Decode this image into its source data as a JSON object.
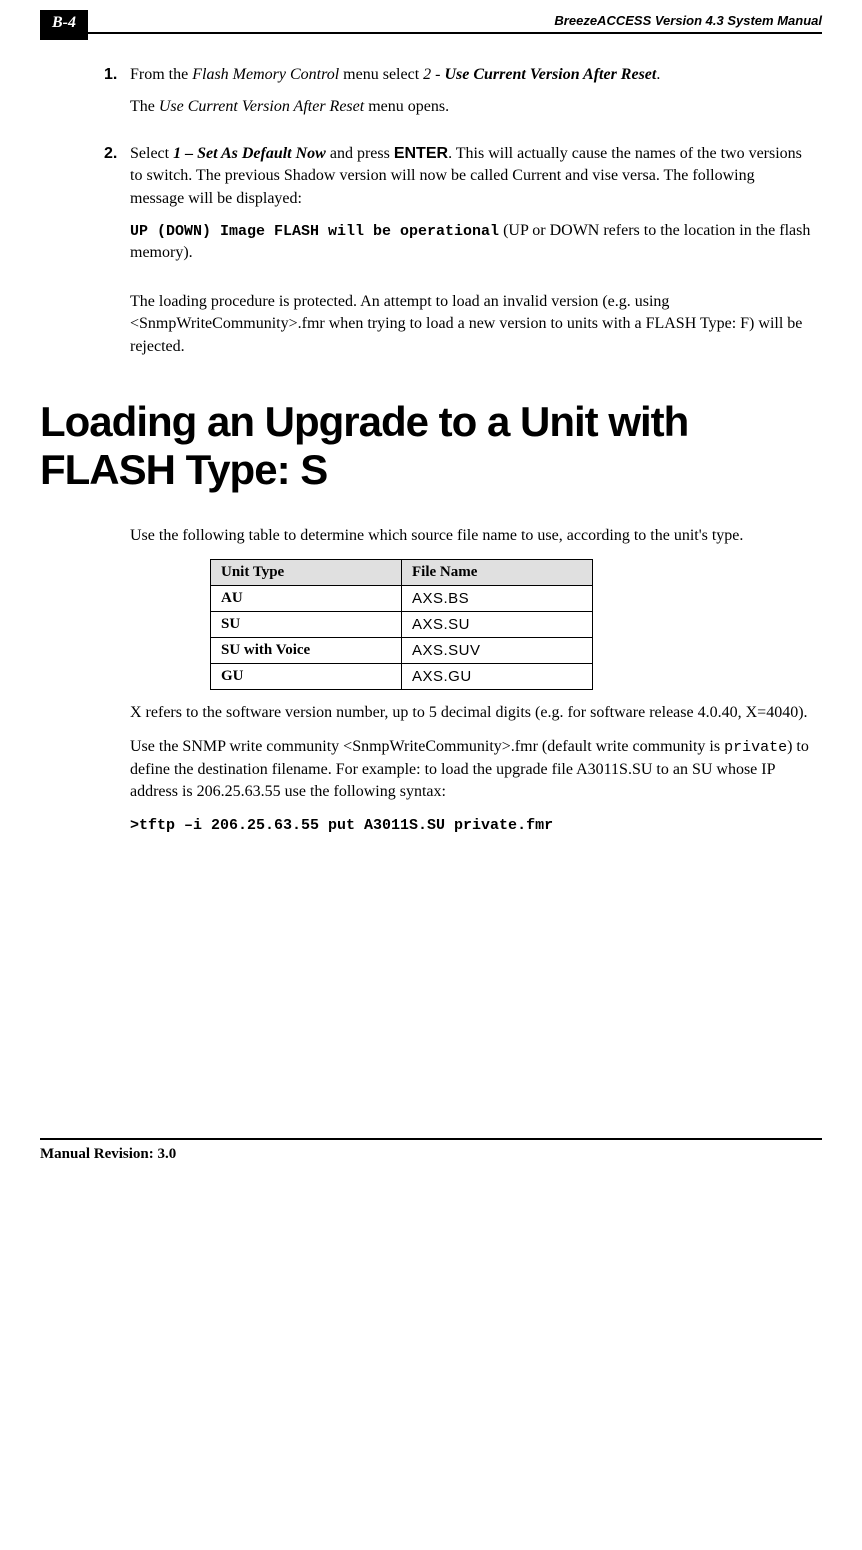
{
  "header": {
    "page_number": "B-4",
    "title": "BreezeACCESS Version 4.3 System Manual"
  },
  "steps": [
    {
      "num": "1.",
      "pre": "From the ",
      "menu": "Flash Memory Control",
      "mid": " menu select ",
      "option_num": "2",
      "sep": " - ",
      "option_label": "Use Current Version After Reset",
      "post": ".",
      "sub": {
        "pre": "The ",
        "menu": "Use Current Version After Reset",
        "post": " menu opens."
      }
    },
    {
      "num": "2.",
      "pre": "Select  ",
      "option": "1 – Set As Default Now",
      "mid": " and press ",
      "key": "ENTER",
      "post": ". This will actually cause  the names of the two versions to switch. The previous Shadow version will now be called Current and vise versa. The following message will be displayed:",
      "sub": {
        "code": "UP (DOWN) Image FLASH will be operational",
        "post": " (UP or DOWN refers to the location in the flash memory)."
      }
    }
  ],
  "loading_note": "The loading procedure is protected. An attempt to load an invalid version (e.g. using <SnmpWriteCommunity>.fmr when trying to load a new version to units with a FLASH Type: F) will be rejected.",
  "section_title": "Loading an Upgrade to a Unit with FLASH Type: S",
  "table_intro": "Use the following table to determine which source file name to use, according to the unit's type.",
  "table": {
    "headers": [
      "Unit Type",
      "File Name"
    ],
    "rows": [
      [
        "AU",
        "AXS.BS"
      ],
      [
        "SU",
        "AXS.SU"
      ],
      [
        "SU with Voice",
        "AXS.SUV"
      ],
      [
        "GU",
        "AXS.GU"
      ]
    ]
  },
  "x_note": "X refers to the software version number, up to 5 decimal digits (e.g. for software release 4.0.40, X=4040).",
  "snmp_para": {
    "pre": "Use the SNMP write community <SnmpWriteCommunity>.fmr (default write community is ",
    "code": "private",
    "post": ") to define the destination filename. For example: to load the upgrade file A3011S.SU to an SU whose IP address is 206.25.63.55 use the following syntax:"
  },
  "command": ">tftp –i 206.25.63.55 put A3011S.SU private.fmr",
  "footer": "Manual Revision: 3.0"
}
